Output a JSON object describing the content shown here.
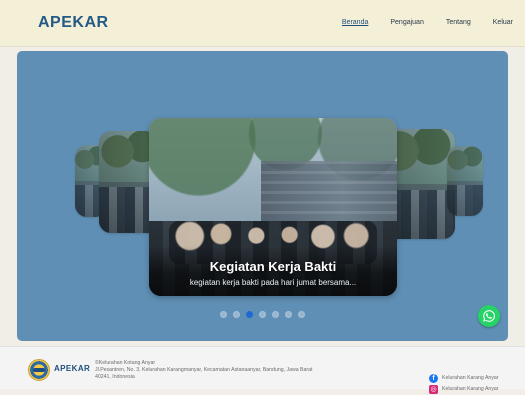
{
  "header": {
    "brand": "APEKAR",
    "nav": [
      {
        "label": "Beranda",
        "active": true
      },
      {
        "label": "Pengajuan"
      },
      {
        "label": "Tentang"
      },
      {
        "label": "Keluar"
      }
    ]
  },
  "carousel": {
    "title": "Kegiatan Kerja Bakti",
    "subtitle": "kegiatan kerja bakti pada hari jumat bersama...",
    "dots_total": 7,
    "active_dot": 2
  },
  "footer": {
    "brand": "APEKAR",
    "address_line1": "©Kelurahan Kotang Anyar",
    "address_line2": "Jl.Pesantren, No. 3, Kelurahan Karangmanyar, Kecamatan Astanaanyar, Bandung, Jawa Barat",
    "address_line3": "40241, Indonesia",
    "social": [
      {
        "icon": "facebook-icon",
        "label": "Kelurahan Karang Anyar"
      },
      {
        "icon": "instagram-icon",
        "label": "Kelurahan Karang Anyar"
      }
    ]
  },
  "colors": {
    "header_bg": "#f4efd7",
    "hero_bg": "#5f8fb5",
    "accent": "#1e6ad2",
    "whatsapp": "#25d366"
  }
}
